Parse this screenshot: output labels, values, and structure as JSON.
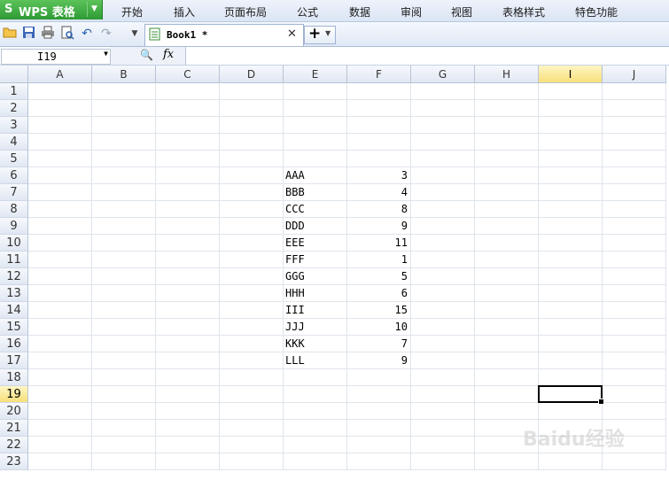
{
  "app": {
    "logo": "S",
    "title": "WPS 表格"
  },
  "menu": [
    "开始",
    "插入",
    "页面布局",
    "公式",
    "数据",
    "审阅",
    "视图",
    "表格样式",
    "特色功能"
  ],
  "toolbar_icons": [
    "open-folder-icon",
    "save-icon",
    "print-icon",
    "print-preview-icon",
    "undo-icon",
    "redo-icon",
    "customize-icon"
  ],
  "tab": {
    "name": "Book1 *"
  },
  "formula": {
    "cell_ref": "I19",
    "value": ""
  },
  "columns": [
    "A",
    "B",
    "C",
    "D",
    "E",
    "F",
    "G",
    "H",
    "I",
    "J"
  ],
  "rows": [
    "1",
    "2",
    "3",
    "4",
    "5",
    "6",
    "7",
    "8",
    "9",
    "10",
    "11",
    "12",
    "13",
    "14",
    "15",
    "16",
    "17",
    "18",
    "19",
    "20",
    "21",
    "22",
    "23"
  ],
  "cells": [
    {
      "ref": "E6",
      "value": "AAA"
    },
    {
      "ref": "F6",
      "value": "3"
    },
    {
      "ref": "E7",
      "value": "BBB"
    },
    {
      "ref": "F7",
      "value": "4"
    },
    {
      "ref": "E8",
      "value": "CCC"
    },
    {
      "ref": "F8",
      "value": "8"
    },
    {
      "ref": "E9",
      "value": "DDD"
    },
    {
      "ref": "F9",
      "value": "9"
    },
    {
      "ref": "E10",
      "value": "EEE"
    },
    {
      "ref": "F10",
      "value": "11"
    },
    {
      "ref": "E11",
      "value": "FFF"
    },
    {
      "ref": "F11",
      "value": "1"
    },
    {
      "ref": "E12",
      "value": "GGG"
    },
    {
      "ref": "F12",
      "value": "5"
    },
    {
      "ref": "E13",
      "value": "HHH"
    },
    {
      "ref": "F13",
      "value": "6"
    },
    {
      "ref": "E14",
      "value": "III"
    },
    {
      "ref": "F14",
      "value": "15"
    },
    {
      "ref": "E15",
      "value": "JJJ"
    },
    {
      "ref": "F15",
      "value": "10"
    },
    {
      "ref": "E16",
      "value": "KKK"
    },
    {
      "ref": "F16",
      "value": "7"
    },
    {
      "ref": "E17",
      "value": "LLL"
    },
    {
      "ref": "F17",
      "value": "9"
    }
  ],
  "selected": {
    "col": "I",
    "row": "19"
  },
  "watermark": "Baidu经验"
}
